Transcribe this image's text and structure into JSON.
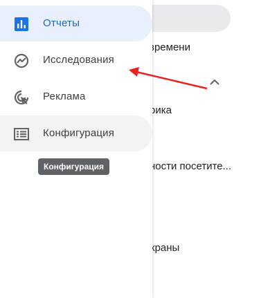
{
  "sidebar": {
    "items": [
      {
        "label": "Отчеты",
        "icon": "bar-chart-icon",
        "state": "active"
      },
      {
        "label": "Исследования",
        "icon": "explore-icon",
        "state": "normal"
      },
      {
        "label": "Реклама",
        "icon": "ads-click-icon",
        "state": "normal"
      },
      {
        "label": "Конфигурация",
        "icon": "list-icon",
        "state": "hover"
      }
    ],
    "tooltip": "Конфигурация"
  },
  "background": {
    "texts": [
      "времени",
      "рика",
      "ности посетите...",
      "краны"
    ]
  },
  "colors": {
    "active_bg": "#e8f0fe",
    "active_text": "#1967d2",
    "active_icon": "#1a73e8",
    "hover_bg": "#f1f3f4",
    "tooltip_bg": "#5f6368",
    "annotation_arrow": "#e8231f"
  }
}
